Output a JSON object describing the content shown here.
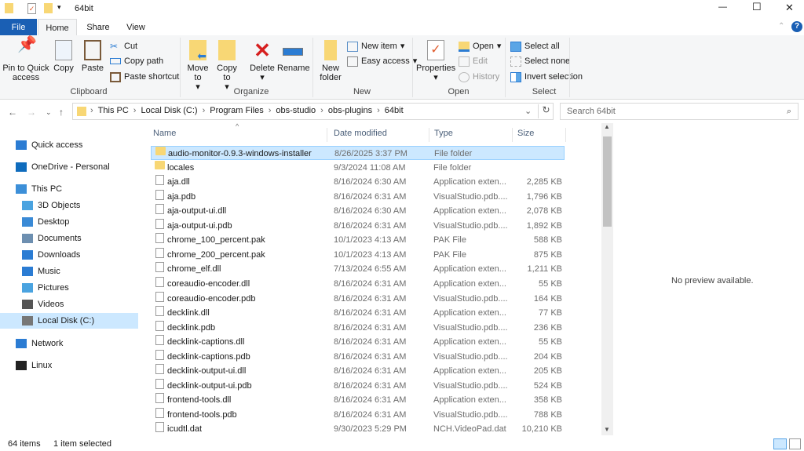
{
  "window": {
    "title": "64bit",
    "minimize": "—",
    "maximize": "☐",
    "close": "✕"
  },
  "tabs": [
    "File",
    "Home",
    "Share",
    "View"
  ],
  "help": "?",
  "ribbon": {
    "clipboard": {
      "label": "Clipboard",
      "pin": "Pin to Quick access",
      "copy": "Copy",
      "paste": "Paste",
      "cut": "Cut",
      "copy_path": "Copy path",
      "paste_shortcut": "Paste shortcut"
    },
    "organize": {
      "label": "Organize",
      "move_to": "Move to",
      "copy_to": "Copy to",
      "delete": "Delete",
      "rename": "Rename"
    },
    "new": {
      "label": "New",
      "new_folder": "New folder",
      "new_item": "New item",
      "easy_access": "Easy access"
    },
    "open": {
      "label": "Open",
      "properties": "Properties",
      "open": "Open",
      "edit": "Edit",
      "history": "History"
    },
    "select": {
      "label": "Select",
      "select_all": "Select all",
      "select_none": "Select none",
      "invert": "Invert selection"
    }
  },
  "address": {
    "crumbs": [
      "This PC",
      "Local Disk (C:)",
      "Program Files",
      "obs-studio",
      "obs-plugins",
      "64bit"
    ]
  },
  "search": {
    "placeholder": "Search 64bit"
  },
  "sidebar": [
    {
      "label": "Quick access",
      "icon": "star-icon",
      "color": "#2b7cd3"
    },
    {
      "label": "OneDrive - Personal",
      "icon": "cloud-icon",
      "color": "#0f6cbd"
    },
    {
      "label": "This PC",
      "icon": "computer-icon",
      "color": "#3c8fd8"
    },
    {
      "label": "3D Objects",
      "icon": "cube-icon",
      "color": "#4aa3e0"
    },
    {
      "label": "Desktop",
      "icon": "desktop-icon",
      "color": "#3a8ad6"
    },
    {
      "label": "Documents",
      "icon": "document-icon",
      "color": "#6d8fb0"
    },
    {
      "label": "Downloads",
      "icon": "download-icon",
      "color": "#2b7cd3"
    },
    {
      "label": "Music",
      "icon": "music-icon",
      "color": "#2b7cd3"
    },
    {
      "label": "Pictures",
      "icon": "picture-icon",
      "color": "#4aa3e0"
    },
    {
      "label": "Videos",
      "icon": "video-icon",
      "color": "#555"
    },
    {
      "label": "Local Disk (C:)",
      "icon": "drive-icon",
      "color": "#777"
    },
    {
      "label": "Network",
      "icon": "network-icon",
      "color": "#2b7cd3"
    },
    {
      "label": "Linux",
      "icon": "linux-icon",
      "color": "#222"
    }
  ],
  "columns": {
    "name": "Name",
    "date": "Date modified",
    "type": "Type",
    "size": "Size"
  },
  "files": [
    {
      "name": "audio-monitor-0.9.3-windows-installer",
      "date": "8/26/2025 3:37 PM",
      "type": "File folder",
      "size": "",
      "kind": "folder"
    },
    {
      "name": "locales",
      "date": "9/3/2024 11:08 AM",
      "type": "File folder",
      "size": "",
      "kind": "folder"
    },
    {
      "name": "aja.dll",
      "date": "8/16/2024 6:30 AM",
      "type": "Application exten...",
      "size": "2,285 KB",
      "kind": "dll"
    },
    {
      "name": "aja.pdb",
      "date": "8/16/2024 6:31 AM",
      "type": "VisualStudio.pdb....",
      "size": "1,796 KB",
      "kind": "file"
    },
    {
      "name": "aja-output-ui.dll",
      "date": "8/16/2024 6:30 AM",
      "type": "Application exten...",
      "size": "2,078 KB",
      "kind": "dll"
    },
    {
      "name": "aja-output-ui.pdb",
      "date": "8/16/2024 6:31 AM",
      "type": "VisualStudio.pdb....",
      "size": "1,892 KB",
      "kind": "file"
    },
    {
      "name": "chrome_100_percent.pak",
      "date": "10/1/2023 4:13 AM",
      "type": "PAK File",
      "size": "588 KB",
      "kind": "file"
    },
    {
      "name": "chrome_200_percent.pak",
      "date": "10/1/2023 4:13 AM",
      "type": "PAK File",
      "size": "875 KB",
      "kind": "file"
    },
    {
      "name": "chrome_elf.dll",
      "date": "7/13/2024 6:55 AM",
      "type": "Application exten...",
      "size": "1,211 KB",
      "kind": "dll"
    },
    {
      "name": "coreaudio-encoder.dll",
      "date": "8/16/2024 6:31 AM",
      "type": "Application exten...",
      "size": "55 KB",
      "kind": "dll"
    },
    {
      "name": "coreaudio-encoder.pdb",
      "date": "8/16/2024 6:31 AM",
      "type": "VisualStudio.pdb....",
      "size": "164 KB",
      "kind": "file"
    },
    {
      "name": "decklink.dll",
      "date": "8/16/2024 6:31 AM",
      "type": "Application exten...",
      "size": "77 KB",
      "kind": "dll"
    },
    {
      "name": "decklink.pdb",
      "date": "8/16/2024 6:31 AM",
      "type": "VisualStudio.pdb....",
      "size": "236 KB",
      "kind": "file"
    },
    {
      "name": "decklink-captions.dll",
      "date": "8/16/2024 6:31 AM",
      "type": "Application exten...",
      "size": "55 KB",
      "kind": "dll"
    },
    {
      "name": "decklink-captions.pdb",
      "date": "8/16/2024 6:31 AM",
      "type": "VisualStudio.pdb....",
      "size": "204 KB",
      "kind": "file"
    },
    {
      "name": "decklink-output-ui.dll",
      "date": "8/16/2024 6:31 AM",
      "type": "Application exten...",
      "size": "205 KB",
      "kind": "dll"
    },
    {
      "name": "decklink-output-ui.pdb",
      "date": "8/16/2024 6:31 AM",
      "type": "VisualStudio.pdb....",
      "size": "524 KB",
      "kind": "file"
    },
    {
      "name": "frontend-tools.dll",
      "date": "8/16/2024 6:31 AM",
      "type": "Application exten...",
      "size": "358 KB",
      "kind": "dll"
    },
    {
      "name": "frontend-tools.pdb",
      "date": "8/16/2024 6:31 AM",
      "type": "VisualStudio.pdb....",
      "size": "788 KB",
      "kind": "file"
    },
    {
      "name": "icudtl.dat",
      "date": "9/30/2023 5:29 PM",
      "type": "NCH.VideoPad.dat",
      "size": "10,210 KB",
      "kind": "file"
    }
  ],
  "preview": {
    "text": "No preview available."
  },
  "status": {
    "count": "64 items",
    "selected": "1 item selected"
  }
}
